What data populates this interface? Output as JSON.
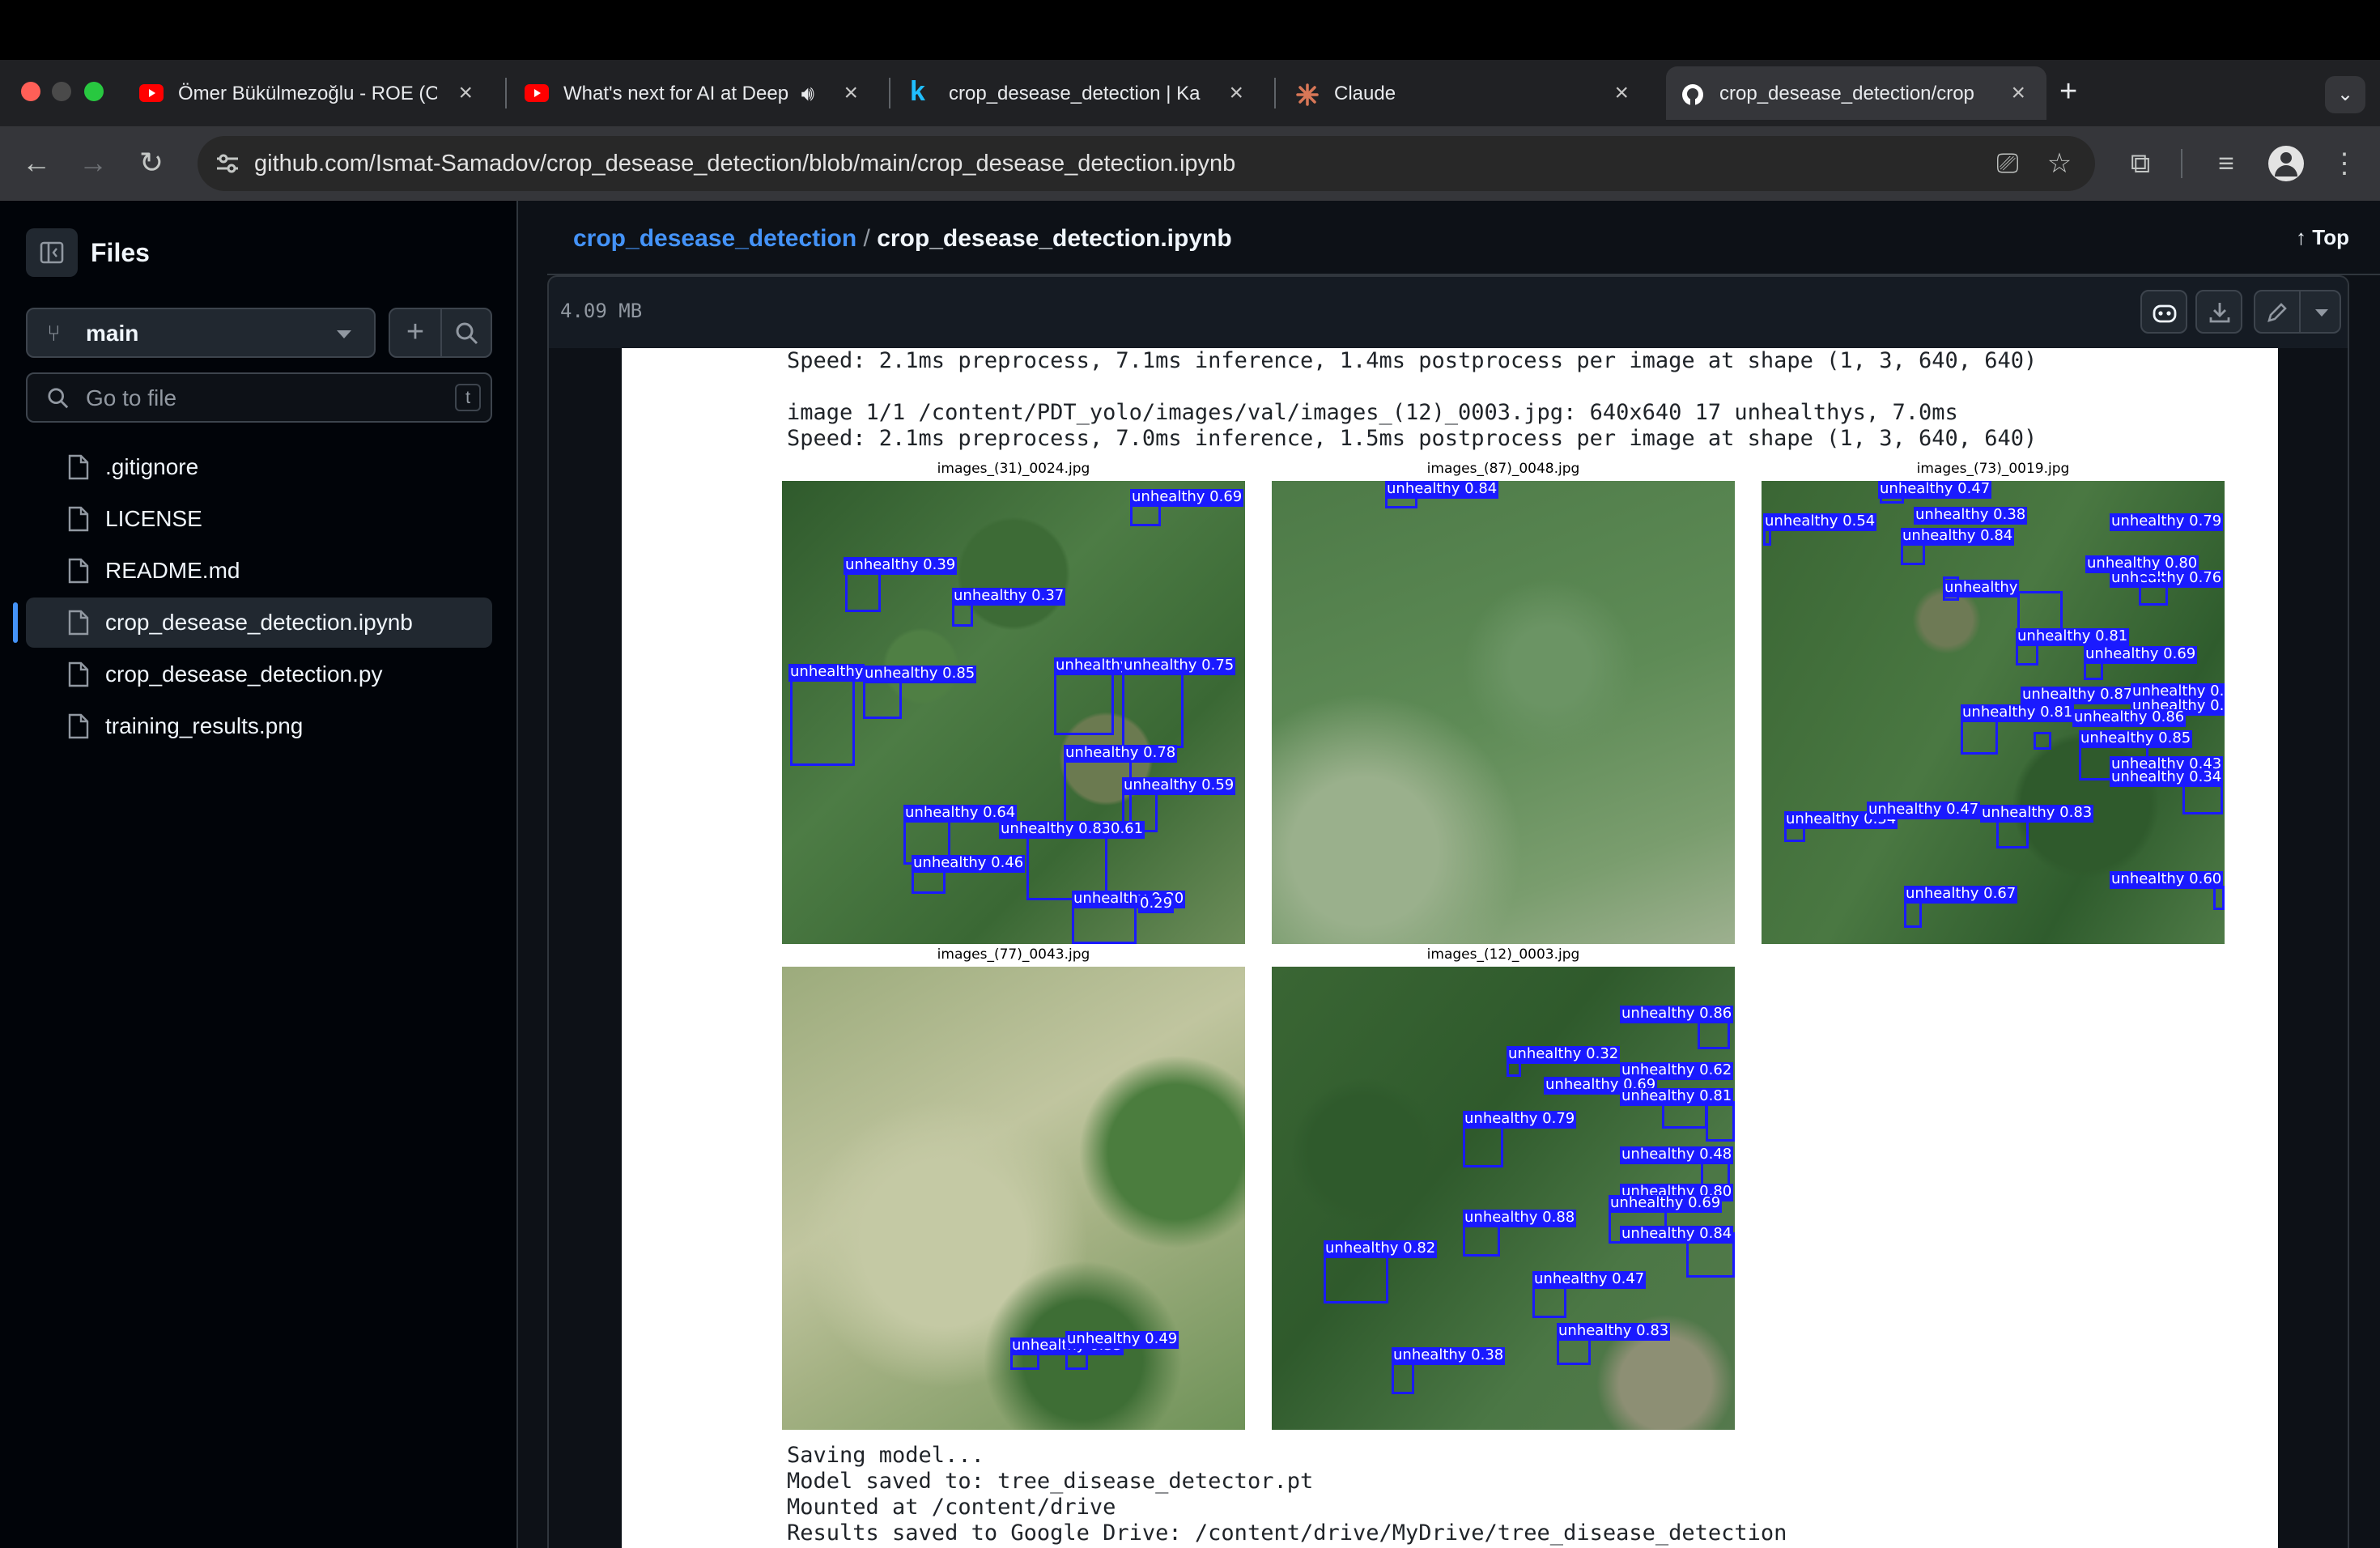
{
  "browser": {
    "tabs": [
      {
        "title": "Ömer Bükülmezoğlu - ROE (O",
        "icon": "youtube-icon",
        "active": false
      },
      {
        "title": "What's next for AI at Deep",
        "icon": "youtube-icon",
        "active": false,
        "audio": true
      },
      {
        "title": "crop_desease_detection | Ka",
        "icon": "kaggle-icon",
        "active": false
      },
      {
        "title": "Claude",
        "icon": "claude-icon",
        "active": false
      },
      {
        "title": "crop_desease_detection/crop",
        "icon": "github-icon",
        "active": true
      }
    ],
    "new_tab": "+",
    "url": "github.com/Ismat-Samadov/crop_desease_detection/blob/main/crop_desease_detection.ipynb"
  },
  "sidebar": {
    "title": "Files",
    "branch": "main",
    "search_placeholder": "Go to file",
    "search_shortcut": "t",
    "files": [
      {
        "name": ".gitignore"
      },
      {
        "name": "LICENSE"
      },
      {
        "name": "README.md"
      },
      {
        "name": "crop_desease_detection.ipynb",
        "selected": true
      },
      {
        "name": "crop_desease_detection.py"
      },
      {
        "name": "training_results.png"
      }
    ]
  },
  "header": {
    "repo": "crop_desease_detection",
    "separator": "/",
    "file": "crop_desease_detection.ipynb",
    "top_label": "Top"
  },
  "filebar": {
    "size": "4.09 MB"
  },
  "notebook": {
    "line1": "Speed: 2.1ms preprocess, 7.1ms inference, 1.4ms postprocess per image at shape (1, 3, 640, 640)",
    "line2": "image 1/1 /content/PDT_yolo/images/val/images_(12)_0003.jpg: 640x640 17 unhealthys, 7.0ms",
    "line3": "Speed: 2.1ms preprocess, 7.0ms inference, 1.5ms postprocess per image at shape (1, 3, 640, 640)",
    "images": [
      {
        "caption": "images_(31)_0024.jpg",
        "labels": [
          "unhealthy 0.69",
          "unhealthy 0.39",
          "unhealthy 0.37",
          "unhealthy",
          "unhealthy 0.85",
          "unhealthy",
          "unhealthy 0.75",
          "unhealthy 0.78",
          "unhealthy 0.59",
          "unhealthy 0.64",
          "unhealthy 0.83",
          "0.61",
          "unhealthy 0.46",
          "unhealthy 0.30",
          "0.29"
        ]
      },
      {
        "caption": "images_(87)_0048.jpg",
        "labels": [
          "unhealthy 0.84"
        ]
      },
      {
        "caption": "images_(73)_0019.jpg",
        "labels": [
          "unhealthy 0.47",
          "unhealthy 0.54",
          "unhealthy 0.38",
          "unhealthy 0.84",
          "unhealthy 0.79",
          "unhealthy 0.80",
          "unhealthy 0.76",
          "unhealthy",
          "unhealthy 0.81",
          "unhealthy 0.69",
          "unhealthy 0.87",
          "unhealthy 0.39",
          "unhealthy 0.76",
          "unhealthy 0.81",
          "unhealthy 0.86",
          "unhealthy 0.85",
          "unhealthy 0.43",
          "unhealthy 0.34",
          "unhealthy 0.54",
          "unhealthy 0.47",
          "unhealthy 0.83",
          "unhealthy 0.67",
          "unhealthy 0.60"
        ]
      },
      {
        "caption": "images_(77)_0043.jpg",
        "labels": [
          "unhealthy 0.49",
          "unhealthy 0.33"
        ]
      },
      {
        "caption": "images_(12)_0003.jpg",
        "labels": [
          "unhealthy 0.86",
          "unhealthy 0.32",
          "unhealthy 0.62",
          "unhealthy 0.69",
          "unhealthy 0.81",
          "unhealthy 0.79",
          "unhealthy 0.48",
          "unhealthy 0.80",
          "unhealthy 0.69",
          "unhealthy 0.88",
          "unhealthy 0.84",
          "unhealthy 0.82",
          "unhealthy 0.47",
          "unhealthy 0.38",
          "unhealthy 0.83"
        ]
      }
    ],
    "out1": "Saving model...",
    "out2": "Model saved to: tree_disease_detector.pt",
    "out3": "Mounted at /content/drive",
    "out4": "Results saved to Google Drive: /content/drive/MyDrive/tree_disease_detection"
  },
  "colors": {
    "accent": "#4493f8",
    "detection": "#1a1aff",
    "selected_indicator": "#4493f8"
  }
}
